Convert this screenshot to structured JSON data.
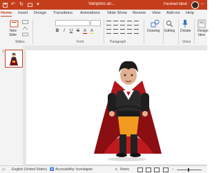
{
  "app": {
    "title": "Vampires an...",
    "user": "Farshad Iqbal"
  },
  "quick_access": {
    "save_icon": "save-icon",
    "undo_icon": "undo-icon",
    "redo_icon": "redo-icon"
  },
  "tabs": [
    "Home",
    "Insert",
    "Design",
    "Transitions",
    "Animations",
    "Slide Show",
    "Review",
    "View",
    "Add-ins",
    "Help"
  ],
  "active_tab": "Home",
  "ribbon": {
    "new_slide_line1": "New",
    "new_slide_line2": "Slide",
    "groups": {
      "slides": "Slides",
      "font": "Font",
      "paragraph": "Paragraph",
      "voice": "Voice"
    },
    "drawing": "Drawing",
    "editing": "Editing",
    "dictate": "Dictate",
    "design_ideas_line1": "Design",
    "design_ideas_line2": "Idea"
  },
  "thumbnails": [
    {
      "number": "1"
    }
  ],
  "status": {
    "language": "English (United States)",
    "accessibility": "Accessibility: Investigate",
    "notes": "Notes"
  },
  "colors": {
    "accent": "#c43e1c",
    "ribbon_bg": "#f3f3f3",
    "canvas_bg": "#e6e6e6"
  }
}
